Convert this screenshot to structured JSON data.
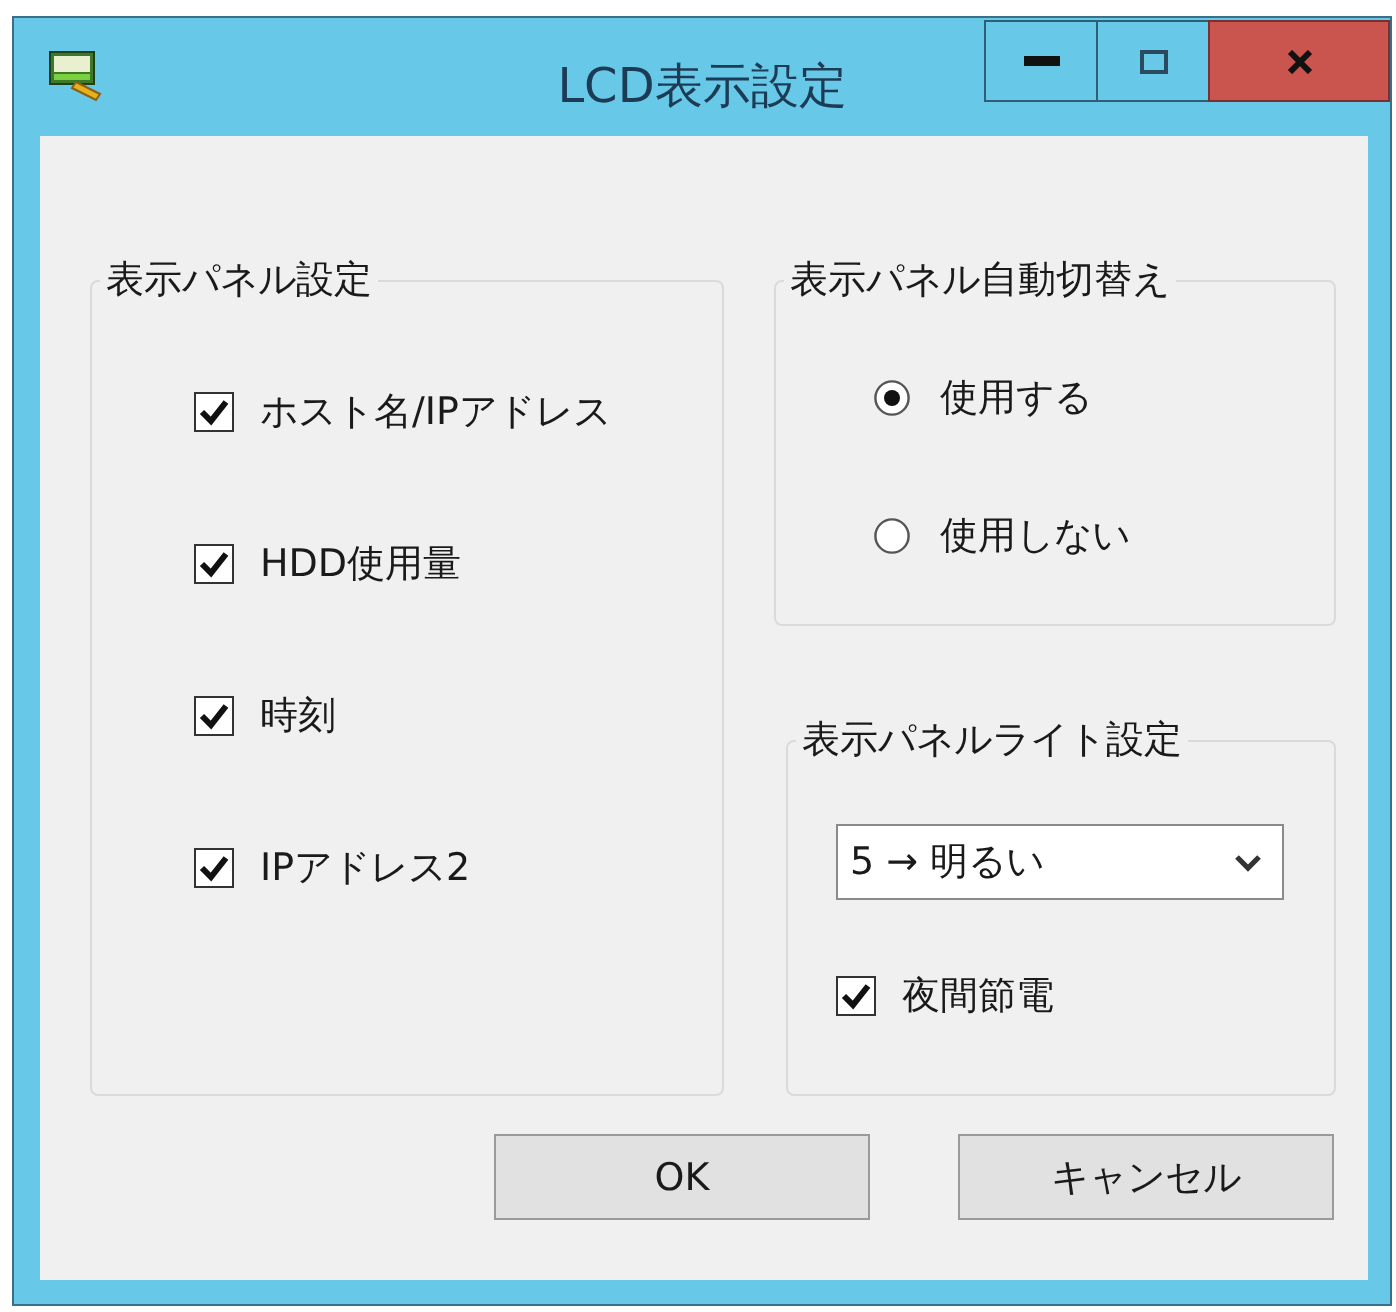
{
  "window": {
    "title": "LCD表示設定"
  },
  "display_panel_settings": {
    "title": "表示パネル設定",
    "items": [
      {
        "label": "ホスト名/IPアドレス",
        "checked": true
      },
      {
        "label": "HDD使用量",
        "checked": true
      },
      {
        "label": "時刻",
        "checked": true
      },
      {
        "label": "IPアドレス2",
        "checked": true
      }
    ]
  },
  "auto_switch": {
    "title": "表示パネル自動切替え",
    "options": [
      {
        "label": "使用する",
        "selected": true
      },
      {
        "label": "使用しない",
        "selected": false
      }
    ]
  },
  "light_settings": {
    "title": "表示パネルライト設定",
    "dropdown": {
      "value": "5 → 明るい"
    },
    "night_saving": {
      "label": "夜間節電",
      "checked": true
    }
  },
  "buttons": [
    {
      "label": "OK"
    },
    {
      "label": "キャンセル"
    }
  ]
}
